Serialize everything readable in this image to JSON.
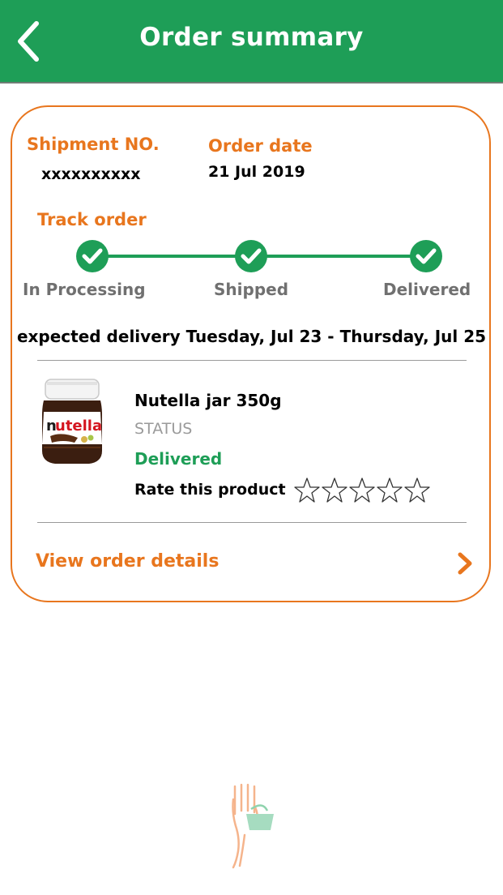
{
  "header": {
    "title": "Order summary",
    "back_icon": "chevron-left-icon",
    "background": "#1e9e57"
  },
  "shipment": {
    "label": "Shipment NO.",
    "value": "xxxxxxxxxx"
  },
  "order_date": {
    "label": "Order date",
    "value": "21 Jul 2019"
  },
  "track": {
    "label": "Track order",
    "steps": [
      "In Processing",
      "Shipped",
      "Delivered"
    ],
    "completed_steps": 3
  },
  "expected_delivery": "expected delivery Tuesday, Jul 23 - Thursday, Jul 25",
  "product": {
    "name": "Nutella jar 350g",
    "status_label": "STATUS",
    "status_value": "Delivered",
    "rate_label": "Rate this product",
    "rating": 0,
    "rating_max": 5,
    "image_brand": "nutella"
  },
  "view_details": {
    "label": "View order details",
    "icon": "chevron-right-icon"
  },
  "colors": {
    "accent_orange": "#e8761e",
    "brand_green": "#1e9e57",
    "muted_gray": "#9a9a9a"
  }
}
